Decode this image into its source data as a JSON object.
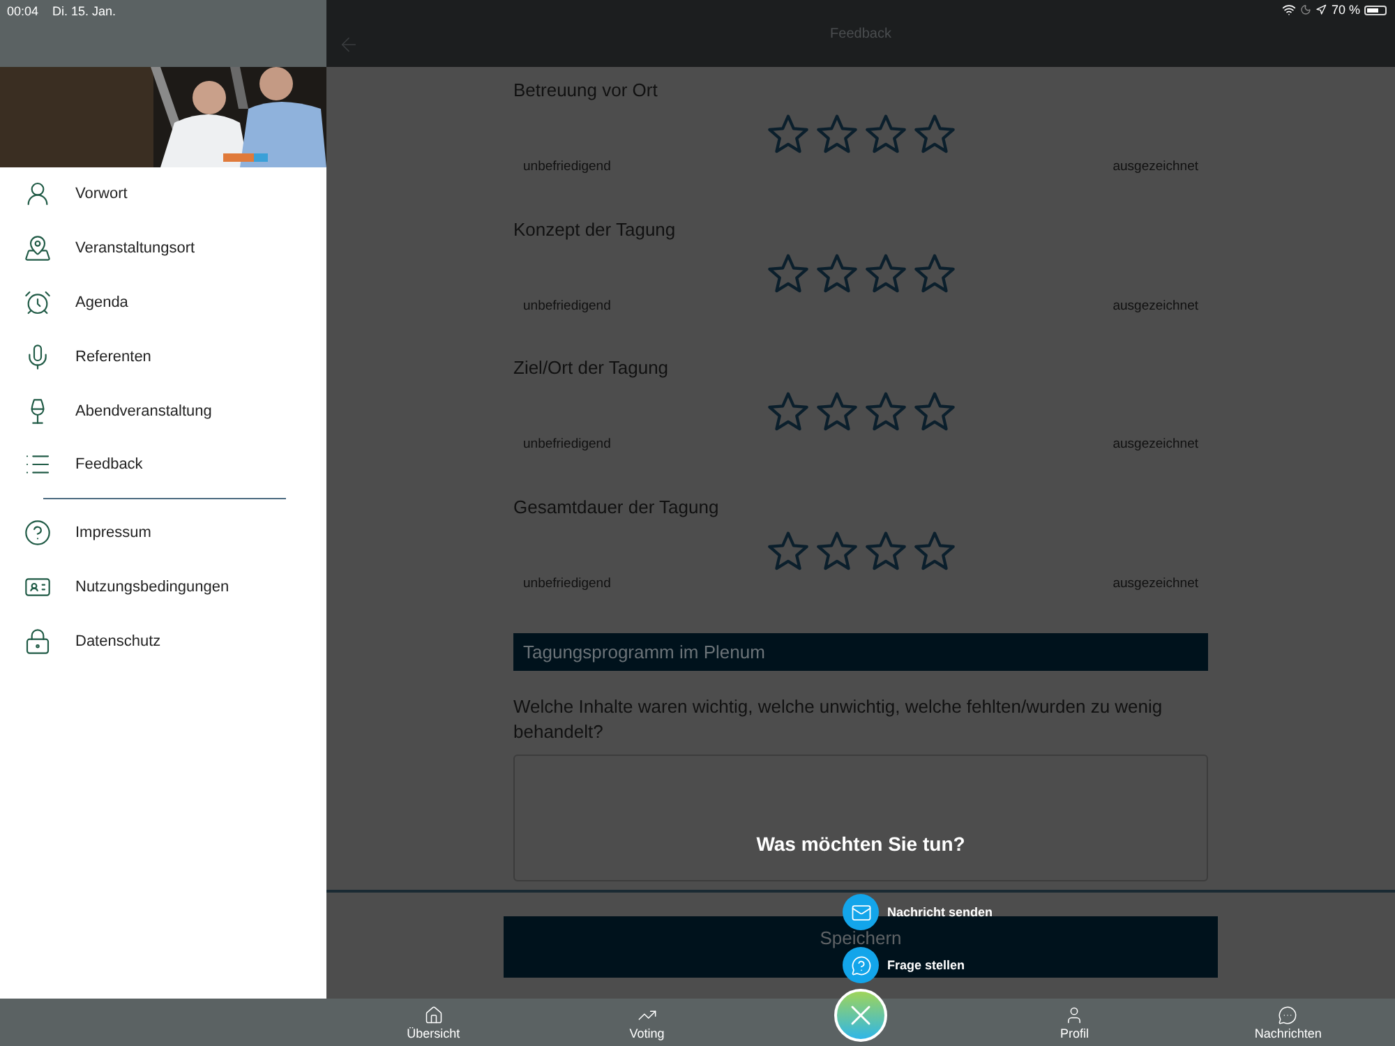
{
  "status_bar": {
    "time": "00:04",
    "date": "Di. 15. Jan.",
    "battery": "70 %"
  },
  "sidebar": {
    "items": [
      {
        "label": "Vorwort"
      },
      {
        "label": "Veranstaltungsort"
      },
      {
        "label": "Agenda"
      },
      {
        "label": "Referenten"
      },
      {
        "label": "Abendveranstaltung"
      },
      {
        "label": "Feedback"
      }
    ],
    "secondary_items": [
      {
        "label": "Impressum"
      },
      {
        "label": "Nutzungsbedingungen"
      },
      {
        "label": "Datenschutz"
      }
    ]
  },
  "header": {
    "title": "Feedback"
  },
  "ratings": [
    {
      "title": "Betreuung vor Ort",
      "stars": 0,
      "low_label": "unbefriedigend",
      "high_label": "ausgezeichnet"
    },
    {
      "title": "Konzept der Tagung",
      "stars": 0,
      "low_label": "unbefriedigend",
      "high_label": "ausgezeichnet"
    },
    {
      "title": "Ziel/Ort der Tagung",
      "stars": 0,
      "low_label": "unbefriedigend",
      "high_label": "ausgezeichnet"
    },
    {
      "title": "Gesamtdauer der Tagung",
      "stars": 0,
      "low_label": "unbefriedigend",
      "high_label": "ausgezeichnet"
    }
  ],
  "section_heading": "Tagungsprogramm im Plenum",
  "question": "Welche Inhalte waren wichtig, welche unwichtig, welche fehlten/wurden zu wenig behandelt?",
  "save_button": "Speichern",
  "action_menu": {
    "title": "Was möchten Sie tun?",
    "actions": [
      {
        "label": "Nachricht senden"
      },
      {
        "label": "Frage stellen"
      }
    ]
  },
  "tabs": [
    {
      "label": "Übersicht"
    },
    {
      "label": "Voting"
    },
    {
      "label": "Profil"
    },
    {
      "label": "Nachrichten"
    }
  ]
}
